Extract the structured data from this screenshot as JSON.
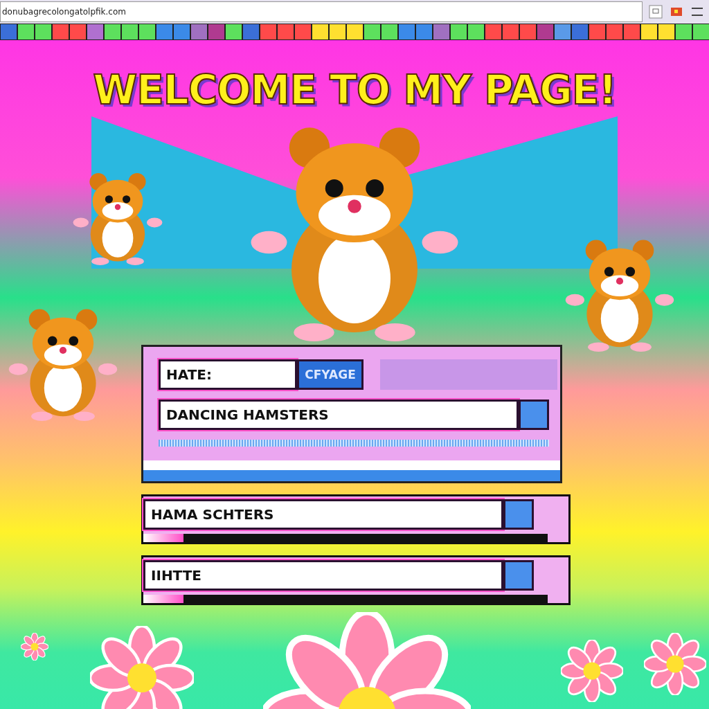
{
  "address_bar": {
    "url": "donubagrecolongatolpfik.com"
  },
  "heading": "WELCOME TO MY PAGE!",
  "form": {
    "name_field": {
      "value": "HATE:"
    },
    "button": "CFYAGE",
    "text_field": {
      "value": "DANCING HAMSTERS"
    }
  },
  "fields": [
    {
      "value": "HAMA SCHTERS",
      "level": 0.1
    },
    {
      "value": "IIHTTE",
      "level": 0.1
    }
  ]
}
